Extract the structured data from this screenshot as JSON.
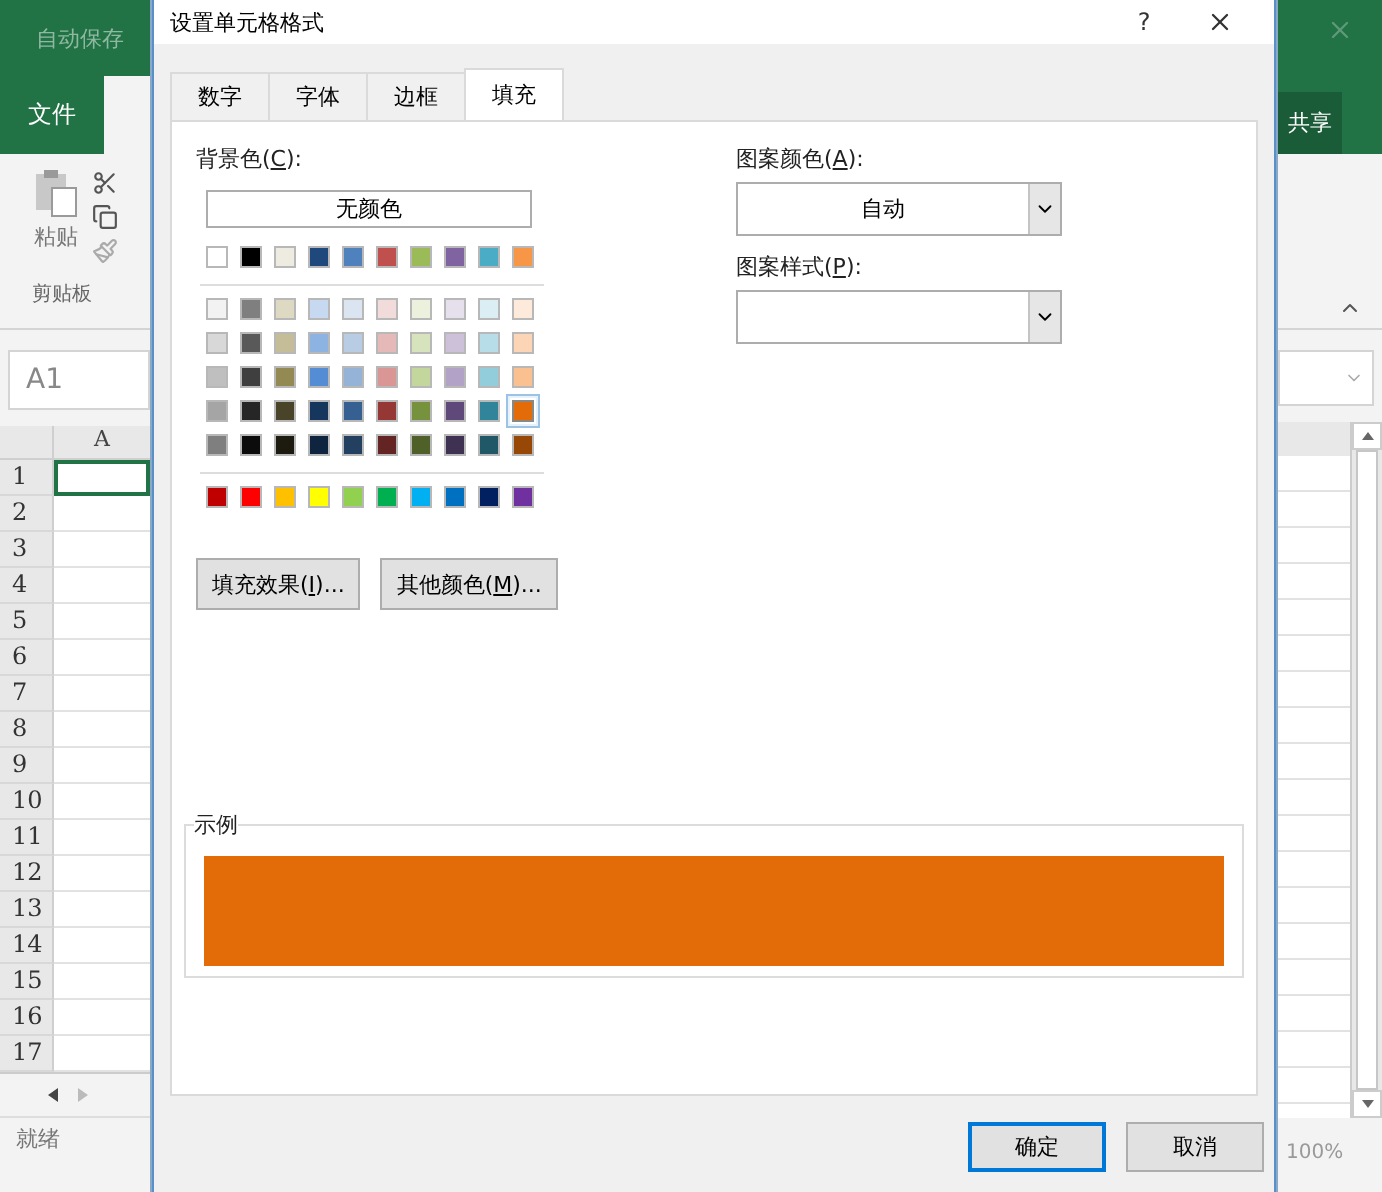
{
  "excel": {
    "autosave": "自动保存",
    "file_tab": "文件",
    "share": "共享",
    "paste": "粘贴",
    "clipboard_group": "剪贴板",
    "name_box": "A1",
    "column": "A",
    "rows": [
      "1",
      "2",
      "3",
      "4",
      "5",
      "6",
      "7",
      "8",
      "9",
      "10",
      "11",
      "12",
      "13",
      "14",
      "15",
      "16",
      "17"
    ],
    "status": "就绪",
    "zoom": "100%"
  },
  "dialog": {
    "title": "设置单元格格式",
    "help": "?",
    "tabs": [
      {
        "label": "数字",
        "selected": false
      },
      {
        "label": "字体",
        "selected": false
      },
      {
        "label": "边框",
        "selected": false
      },
      {
        "label": "填充",
        "selected": true
      }
    ],
    "background_label": {
      "before": "背景色(",
      "key": "C",
      "after": "):"
    },
    "no_color": "无颜色",
    "color_rows": [
      {
        "kind": "base",
        "swatches": [
          {
            "color": "#ffffff",
            "selected": false
          },
          {
            "color": "#000000",
            "selected": false
          },
          {
            "color": "#eeece1",
            "selected": false
          },
          {
            "color": "#1f497d",
            "selected": false
          },
          {
            "color": "#4f81bd",
            "selected": false
          },
          {
            "color": "#c0504d",
            "selected": false
          },
          {
            "color": "#9bbb59",
            "selected": false
          },
          {
            "color": "#8064a2",
            "selected": false
          },
          {
            "color": "#4bacc6",
            "selected": false
          },
          {
            "color": "#f79646",
            "selected": false
          }
        ]
      },
      {
        "kind": "tint",
        "swatches": [
          {
            "color": "#f2f2f2",
            "selected": false
          },
          {
            "color": "#7f7f7f",
            "selected": false
          },
          {
            "color": "#ddd9c3",
            "selected": false
          },
          {
            "color": "#c6d9f0",
            "selected": false
          },
          {
            "color": "#dbe5f1",
            "selected": false
          },
          {
            "color": "#f2dcdb",
            "selected": false
          },
          {
            "color": "#ebf1dd",
            "selected": false
          },
          {
            "color": "#e5e0ec",
            "selected": false
          },
          {
            "color": "#dbeef3",
            "selected": false
          },
          {
            "color": "#fdeada",
            "selected": false
          }
        ]
      },
      {
        "kind": "tint",
        "swatches": [
          {
            "color": "#d8d8d8",
            "selected": false
          },
          {
            "color": "#595959",
            "selected": false
          },
          {
            "color": "#c4bd97",
            "selected": false
          },
          {
            "color": "#8db3e2",
            "selected": false
          },
          {
            "color": "#b8cce4",
            "selected": false
          },
          {
            "color": "#e5b9b7",
            "selected": false
          },
          {
            "color": "#d7e3bc",
            "selected": false
          },
          {
            "color": "#ccc1d9",
            "selected": false
          },
          {
            "color": "#b7dde8",
            "selected": false
          },
          {
            "color": "#fbd5b5",
            "selected": false
          }
        ]
      },
      {
        "kind": "tint",
        "swatches": [
          {
            "color": "#bfbfbf",
            "selected": false
          },
          {
            "color": "#3f3f3f",
            "selected": false
          },
          {
            "color": "#938953",
            "selected": false
          },
          {
            "color": "#548dd4",
            "selected": false
          },
          {
            "color": "#95b3d7",
            "selected": false
          },
          {
            "color": "#d99694",
            "selected": false
          },
          {
            "color": "#c3d69b",
            "selected": false
          },
          {
            "color": "#b2a2c7",
            "selected": false
          },
          {
            "color": "#92cddc",
            "selected": false
          },
          {
            "color": "#fac08f",
            "selected": false
          }
        ]
      },
      {
        "kind": "tint",
        "swatches": [
          {
            "color": "#a5a5a5",
            "selected": false
          },
          {
            "color": "#262626",
            "selected": false
          },
          {
            "color": "#494429",
            "selected": false
          },
          {
            "color": "#17365d",
            "selected": false
          },
          {
            "color": "#366092",
            "selected": false
          },
          {
            "color": "#953734",
            "selected": false
          },
          {
            "color": "#76923c",
            "selected": false
          },
          {
            "color": "#5f497a",
            "selected": false
          },
          {
            "color": "#31859b",
            "selected": false
          },
          {
            "color": "#e36c09",
            "selected": true
          }
        ]
      },
      {
        "kind": "tint",
        "swatches": [
          {
            "color": "#7f7f7f",
            "selected": false
          },
          {
            "color": "#0c0c0c",
            "selected": false
          },
          {
            "color": "#1d1b10",
            "selected": false
          },
          {
            "color": "#0f243e",
            "selected": false
          },
          {
            "color": "#244061",
            "selected": false
          },
          {
            "color": "#632423",
            "selected": false
          },
          {
            "color": "#4f6128",
            "selected": false
          },
          {
            "color": "#3f3151",
            "selected": false
          },
          {
            "color": "#205867",
            "selected": false
          },
          {
            "color": "#974806",
            "selected": false
          }
        ]
      },
      {
        "kind": "standard",
        "swatches": [
          {
            "color": "#c00000",
            "selected": false
          },
          {
            "color": "#ff0000",
            "selected": false
          },
          {
            "color": "#ffc000",
            "selected": false
          },
          {
            "color": "#ffff00",
            "selected": false
          },
          {
            "color": "#92d050",
            "selected": false
          },
          {
            "color": "#00b050",
            "selected": false
          },
          {
            "color": "#00b0f0",
            "selected": false
          },
          {
            "color": "#0070c0",
            "selected": false
          },
          {
            "color": "#002060",
            "selected": false
          },
          {
            "color": "#7030a0",
            "selected": false
          }
        ]
      }
    ],
    "fill_effects": {
      "before": "填充效果(",
      "key": "I",
      "after": ")..."
    },
    "more_colors": {
      "before": "其他颜色(",
      "key": "M",
      "after": ")..."
    },
    "pattern_color_label": {
      "before": "图案颜色(",
      "key": "A",
      "after": "):"
    },
    "pattern_color": "自动",
    "pattern_style_label": {
      "before": "图案样式(",
      "key": "P",
      "after": "):"
    },
    "sample_label": "示例",
    "ok": "确定",
    "cancel": "取消"
  }
}
